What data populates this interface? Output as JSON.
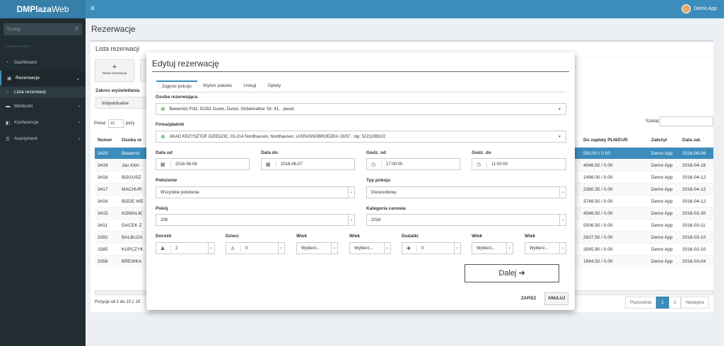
{
  "app": {
    "logo_strong": "DMPlaza",
    "logo_rest": "Web",
    "user": "Demo App"
  },
  "sidebar": {
    "search_placeholder": "Szukaj",
    "menu_header": "GŁÓWNE MENU",
    "items": [
      {
        "label": "Dashboard",
        "icon": "dashboard-icon"
      },
      {
        "label": "Rezerwacje",
        "icon": "calendar-icon"
      },
      {
        "label": "Lista rezerwacji",
        "icon": "circle-icon"
      },
      {
        "label": "Meldunki",
        "icon": "bed-icon"
      },
      {
        "label": "Konferencje",
        "icon": "book-icon"
      },
      {
        "label": "Asortyment",
        "icon": "list-icon"
      }
    ]
  },
  "page": {
    "title": "Rezerwacje"
  },
  "list": {
    "title": "Lista rezerwacji",
    "new_label": "Nowa rezerwacja",
    "zakres_label": "Zakres wyświetlania",
    "indyw": "Indywidualne",
    "pokaz": "Pokaż",
    "pokaz_val": "10",
    "pozycji": "pozy",
    "szukaj": "Szukaj:",
    "cols": [
      "Numer",
      "Osoba re",
      "Do zapłaty PLN/EUR",
      "Założył",
      "Data zał."
    ],
    "rows": [
      {
        "num": "3420",
        "osoba": "Bewernit",
        "zap": "500.00 / 0.00",
        "zal": "Demo App",
        "data": "2016-06-06"
      },
      {
        "num": "3419",
        "osoba": "Jan Klim",
        "zap": "4046.50 / 0.00",
        "zal": "Demo App",
        "data": "2016-04-16"
      },
      {
        "num": "3418",
        "osoba": "BOGUSZ",
        "zap": "1498.00 / 0.00",
        "zal": "Demo App",
        "data": "2016-04-12"
      },
      {
        "num": "3417",
        "osoba": "MACHUR",
        "zap": "2380.35 / 0.00",
        "zal": "Demo App",
        "data": "2016-04-12"
      },
      {
        "num": "3416",
        "osoba": "BODE WE",
        "zap": "3748.50 / 0.00",
        "zal": "Demo App",
        "data": "2016-04-12"
      },
      {
        "num": "3415",
        "osoba": "KOWALIK",
        "zap": "4546.50 / 0.00",
        "zal": "Demo App",
        "data": "2016-03-30"
      },
      {
        "num": "3411",
        "osoba": "GACEK Z",
        "zap": "5006.50 / 0.00",
        "zal": "Demo App",
        "data": "2016-03-11"
      },
      {
        "num": "3392",
        "osoba": "BALBUZA",
        "zap": "2637.50 / 0.00",
        "zal": "Demo App",
        "data": "2016-03-10"
      },
      {
        "num": "3385",
        "osoba": "KUPCZYK",
        "zap": "3545.90 / 0.00",
        "zal": "Demo App",
        "data": "2016-03-10"
      },
      {
        "num": "3358",
        "osoba": "BREWKA",
        "zap": "1694.50 / 0.00",
        "zal": "Demo App",
        "data": "2016-03-04"
      }
    ],
    "pozycje": "Pozycje od 1 do 10 z 19",
    "pager": {
      "prev": "Poprzednia",
      "p1": "1",
      "p2": "2",
      "next": "Następna"
    }
  },
  "modal": {
    "title": "Edytuj rezerwację",
    "tabs": [
      "Zajęcie pokoju",
      "Wybór pakietu",
      "Usługi",
      "Opłaty"
    ],
    "osoba_label": "Osoba rezerwująca",
    "osoba_val": "Bewernitz Fritz, 52351 Duren, Duren, Girbelsrather Str. 41, , pesel:",
    "firma_label": "Firma/płatnik",
    "firma_val": "AKAD KRZYSZTOF DZIEDZIC, 03-214 Nordhausen, Nordhausen, ul.KRASNOBRODZKA 19/37 , nip: 5221289102",
    "data_od_label": "Data od",
    "data_od": "2016-06-06",
    "data_do_label": "Data do",
    "data_do": "2016-06-07",
    "godz_od_label": "Godz. od",
    "godz_od": "17:00:00",
    "godz_do_label": "Godz. do",
    "godz_do": "11:00:00",
    "polozenie_label": "Położenie",
    "polozenie": "Wszystkie położenia",
    "typ_label": "Typ pokoju",
    "typ": "Dwuosobowy",
    "pokoj_label": "Pokój",
    "pokoj": "208",
    "kat_label": "Kategoria cenowa",
    "kat": "2016",
    "dorosli_label": "Dorośli",
    "dorosli": "2",
    "dzieci_label": "Dzieci",
    "dzieci": "0",
    "wiek_label": "Wiek",
    "wybierz": "Wybierz...",
    "dodatki_label": "Dodatki",
    "dodatki": "0",
    "dalej": "Dalej",
    "zapisz": "ZAPISZ",
    "anuluj": "ANULUJ"
  }
}
